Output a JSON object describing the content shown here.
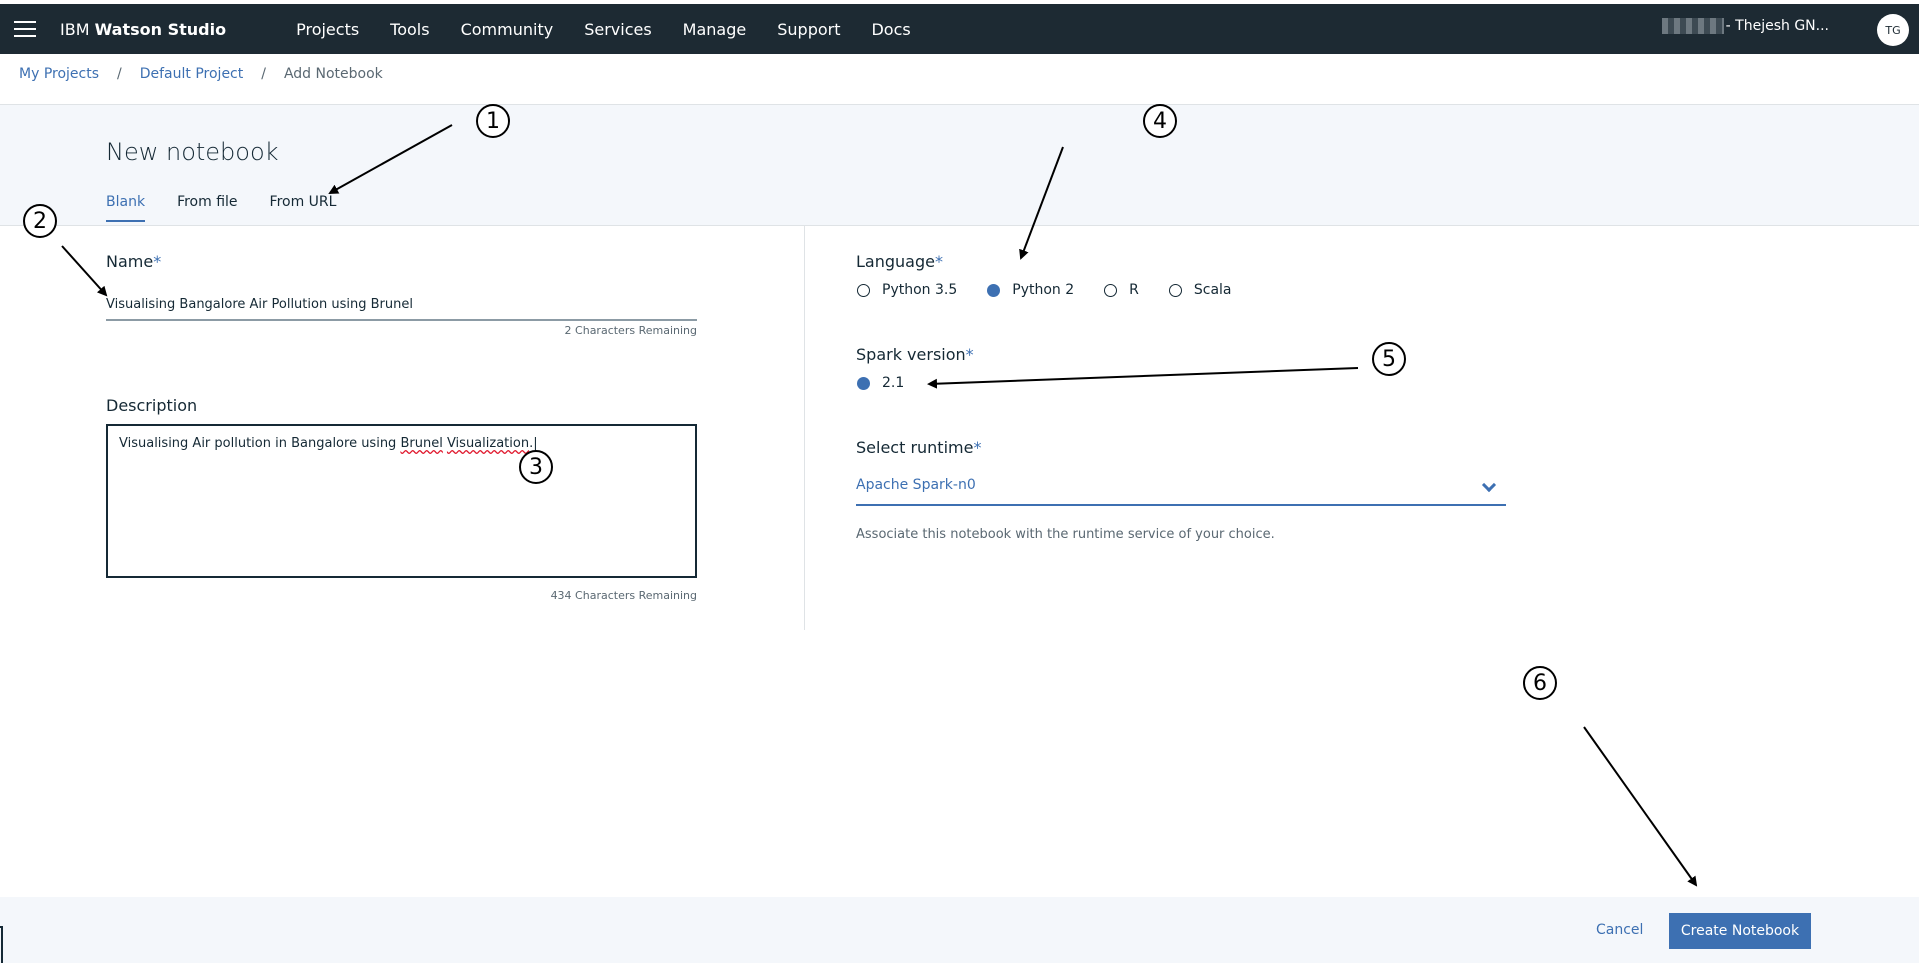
{
  "topbar": {
    "brand_prefix": "IBM",
    "brand_name": "Watson Studio",
    "nav": [
      "Projects",
      "Tools",
      "Community",
      "Services",
      "Manage",
      "Support",
      "Docs"
    ],
    "user_name": "- Thejesh GN...",
    "avatar_initials": "TG"
  },
  "breadcrumb": {
    "items": [
      "My Projects",
      "Default Project"
    ],
    "current": "Add Notebook",
    "separator": "/"
  },
  "header": {
    "title": "New notebook",
    "tabs": [
      "Blank",
      "From file",
      "From URL"
    ],
    "active_tab": "Blank"
  },
  "form": {
    "required_mark": "*",
    "name_label": "Name",
    "name_value": "Visualising Bangalore Air Pollution using Brunel",
    "name_counter": "2 Characters Remaining",
    "description_label": "Description",
    "description_parts": [
      "Visualising Air pollution in Bangalore using ",
      "Brunel",
      " ",
      "Visualization",
      ".|"
    ],
    "description_counter": "434 Characters Remaining",
    "language_label": "Language",
    "languages": [
      "Python 3.5",
      "Python 2",
      "R",
      "Scala"
    ],
    "language_selected": "Python 2",
    "spark_label": "Spark version",
    "spark_options": [
      "2.1"
    ],
    "runtime_label": "Select runtime",
    "runtime_value": "Apache Spark-n0",
    "runtime_helper": "Associate this notebook with the runtime service of your choice."
  },
  "footer": {
    "cancel_label": "Cancel",
    "create_label": "Create Notebook"
  },
  "annotations": [
    "1",
    "2",
    "3",
    "4",
    "5",
    "6"
  ],
  "colors": {
    "topbar_bg": "#1d2a33",
    "accent": "#3d70b2",
    "band_bg": "#f4f7fb",
    "text": "#152935"
  }
}
